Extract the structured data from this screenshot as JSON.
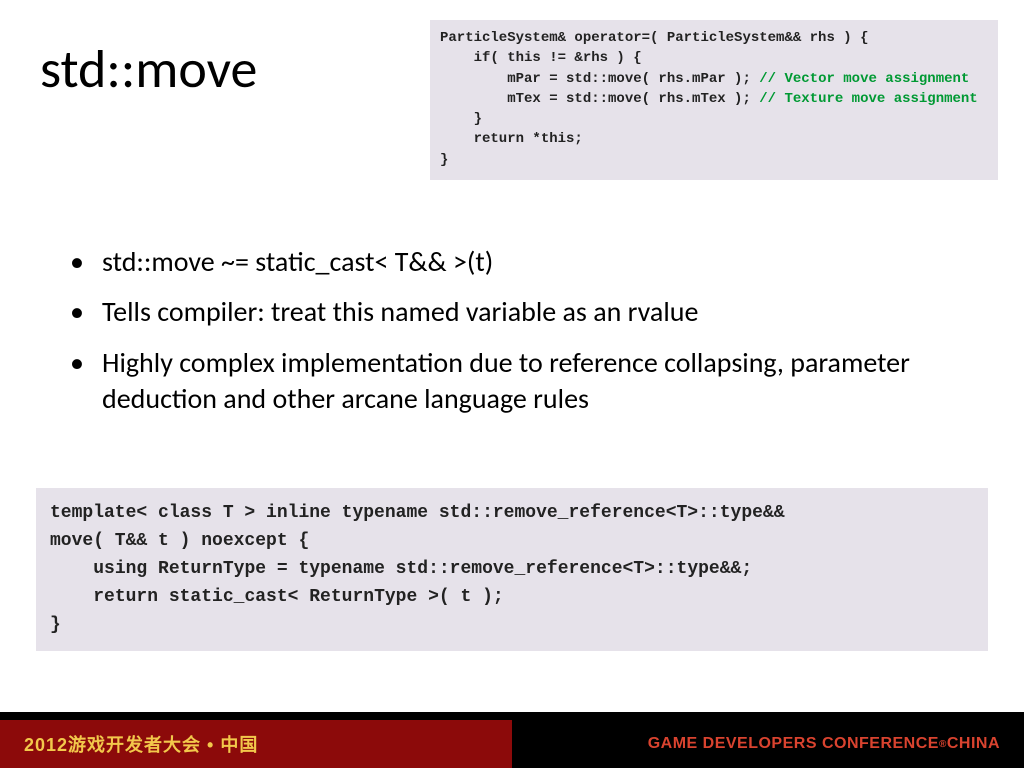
{
  "title": "std::move",
  "code_top": {
    "l1": "ParticleSystem& operator=( ParticleSystem&& rhs ) {",
    "l2": "    if( this != &rhs ) {",
    "l3a": "        mPar = std::move( rhs.mPar ); ",
    "l3c": "// Vector move assignment",
    "l4a": "        mTex = std::move( rhs.mTex ); ",
    "l4c": "// Texture move assignment",
    "l5": "    }",
    "l6": "    return *this;",
    "l7": "}"
  },
  "bullets": [
    "std::move ~= static_cast< T&& >(t)",
    "Tells compiler: treat this named variable as an rvalue",
    "Highly complex implementation due to reference collapsing, parameter deduction and other arcane language rules"
  ],
  "code_bottom": "template< class T > inline typename std::remove_reference<T>::type&&\nmove( T&& t ) noexcept {\n    using ReturnType = typename std::remove_reference<T>::type&&;\n    return static_cast< ReturnType >( t );\n}",
  "footer": {
    "left": "2012游戏开发者大会 • 中国",
    "right_a": "GAME DEVELOPERS CONFERENCE",
    "right_reg": "®",
    "right_b": " CHINA"
  }
}
